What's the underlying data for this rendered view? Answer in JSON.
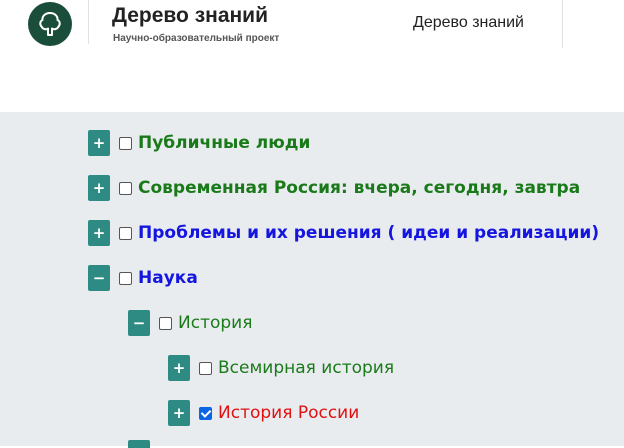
{
  "header": {
    "logo_icon": "tree-icon",
    "title": "Дерево знаний",
    "subtitle": "Научно-образовательный проект",
    "nav_link": "Дерево знаний"
  },
  "tree": {
    "colors": {
      "toggle": "#2e8b84",
      "green": "#1a7a1a",
      "blue": "#1515e0",
      "red": "#e01010",
      "background": "#e9ecef"
    },
    "nodes": [
      {
        "toggle": "+",
        "checked": false,
        "label": "Публичные люди",
        "level": 0,
        "bold": true,
        "color": "green"
      },
      {
        "toggle": "+",
        "checked": false,
        "label": "Современная Россия: вчера, сегодня, завтра",
        "level": 0,
        "bold": true,
        "color": "green"
      },
      {
        "toggle": "+",
        "checked": false,
        "label": "Проблемы и их решения ( идеи и реализации)",
        "level": 0,
        "bold": true,
        "color": "blue"
      },
      {
        "toggle": "−",
        "checked": false,
        "label": "Наука",
        "level": 0,
        "bold": true,
        "color": "blue"
      },
      {
        "toggle": "−",
        "checked": false,
        "label": "История",
        "level": 1,
        "bold": false,
        "color": "green"
      },
      {
        "toggle": "+",
        "checked": false,
        "label": "Всемирная история",
        "level": 2,
        "bold": false,
        "color": "green"
      },
      {
        "toggle": "+",
        "checked": true,
        "label": "История России",
        "level": 2,
        "bold": false,
        "color": "red"
      }
    ]
  }
}
